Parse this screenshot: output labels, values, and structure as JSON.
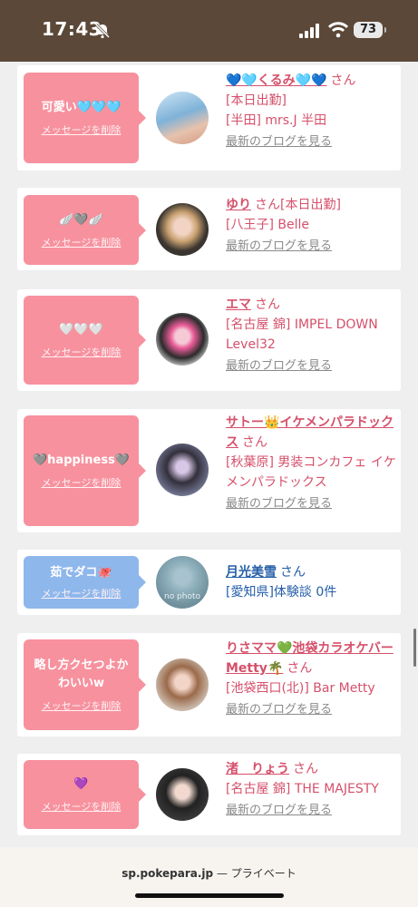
{
  "status": {
    "time": "17:43",
    "battery": "73"
  },
  "cards": [
    {
      "message": "可愛い🩵🩵🩵",
      "delete": "メッセージを削除",
      "color": "pink",
      "name": "💙🩵くるみ🩵💙",
      "san": "さん",
      "lines": [
        "[本日出勤]",
        "[半田] mrs.J 半田"
      ],
      "blog": "最新のブログを見る"
    },
    {
      "message": "🪽🩶🪽",
      "delete": "メッセージを削除",
      "color": "pink",
      "name": "ゆり",
      "san": "さん[本日出勤]",
      "lines": [
        "[八王子] Belle"
      ],
      "blog": "最新のブログを見る"
    },
    {
      "message": "🤍🤍🤍",
      "delete": "メッセージを削除",
      "color": "pink",
      "name": "エマ",
      "san": "さん",
      "lines": [
        "[名古屋 錦] IMPEL DOWN Level32"
      ],
      "blog": "最新のブログを見る"
    },
    {
      "message": "🩶happiness🩶",
      "delete": "メッセージを削除",
      "color": "pink",
      "name": "サトー👑イケメンパラドックス",
      "san": "さん",
      "lines": [
        "[秋葉原] 男装コンカフェ イケメンパラドックス"
      ],
      "blog": "最新のブログを見る"
    },
    {
      "message": "茹でダコ🐙",
      "delete": "メッセージを削除",
      "color": "blue",
      "name": "月光美雪",
      "san": "さん",
      "lines": [
        "[愛知県]体験談 0件"
      ],
      "blog": "",
      "avatar_text": "no photo"
    },
    {
      "message": "略し方クセつよかわいいw",
      "delete": "メッセージを削除",
      "color": "pink",
      "name": "りさママ💚池袋カラオケバーMetty🌴",
      "san": "さん",
      "lines": [
        "[池袋西口(北)] Bar Metty"
      ],
      "blog": "最新のブログを見る"
    },
    {
      "message": "💜",
      "delete": "メッセージを削除",
      "color": "pink",
      "name": "渚　りょう",
      "san": "さん",
      "lines": [
        "[名古屋 錦] THE MAJESTY"
      ],
      "blog": "最新のブログを見る"
    }
  ],
  "addressbar": {
    "domain": "sp.pokepara.jp",
    "suffix": " — プライベート"
  },
  "colors": {
    "pink": "#f7919e",
    "blue": "#8eb7ec",
    "name_pink": "#d5506a",
    "name_blue": "#245ea8",
    "statusbar": "#5b4838"
  }
}
